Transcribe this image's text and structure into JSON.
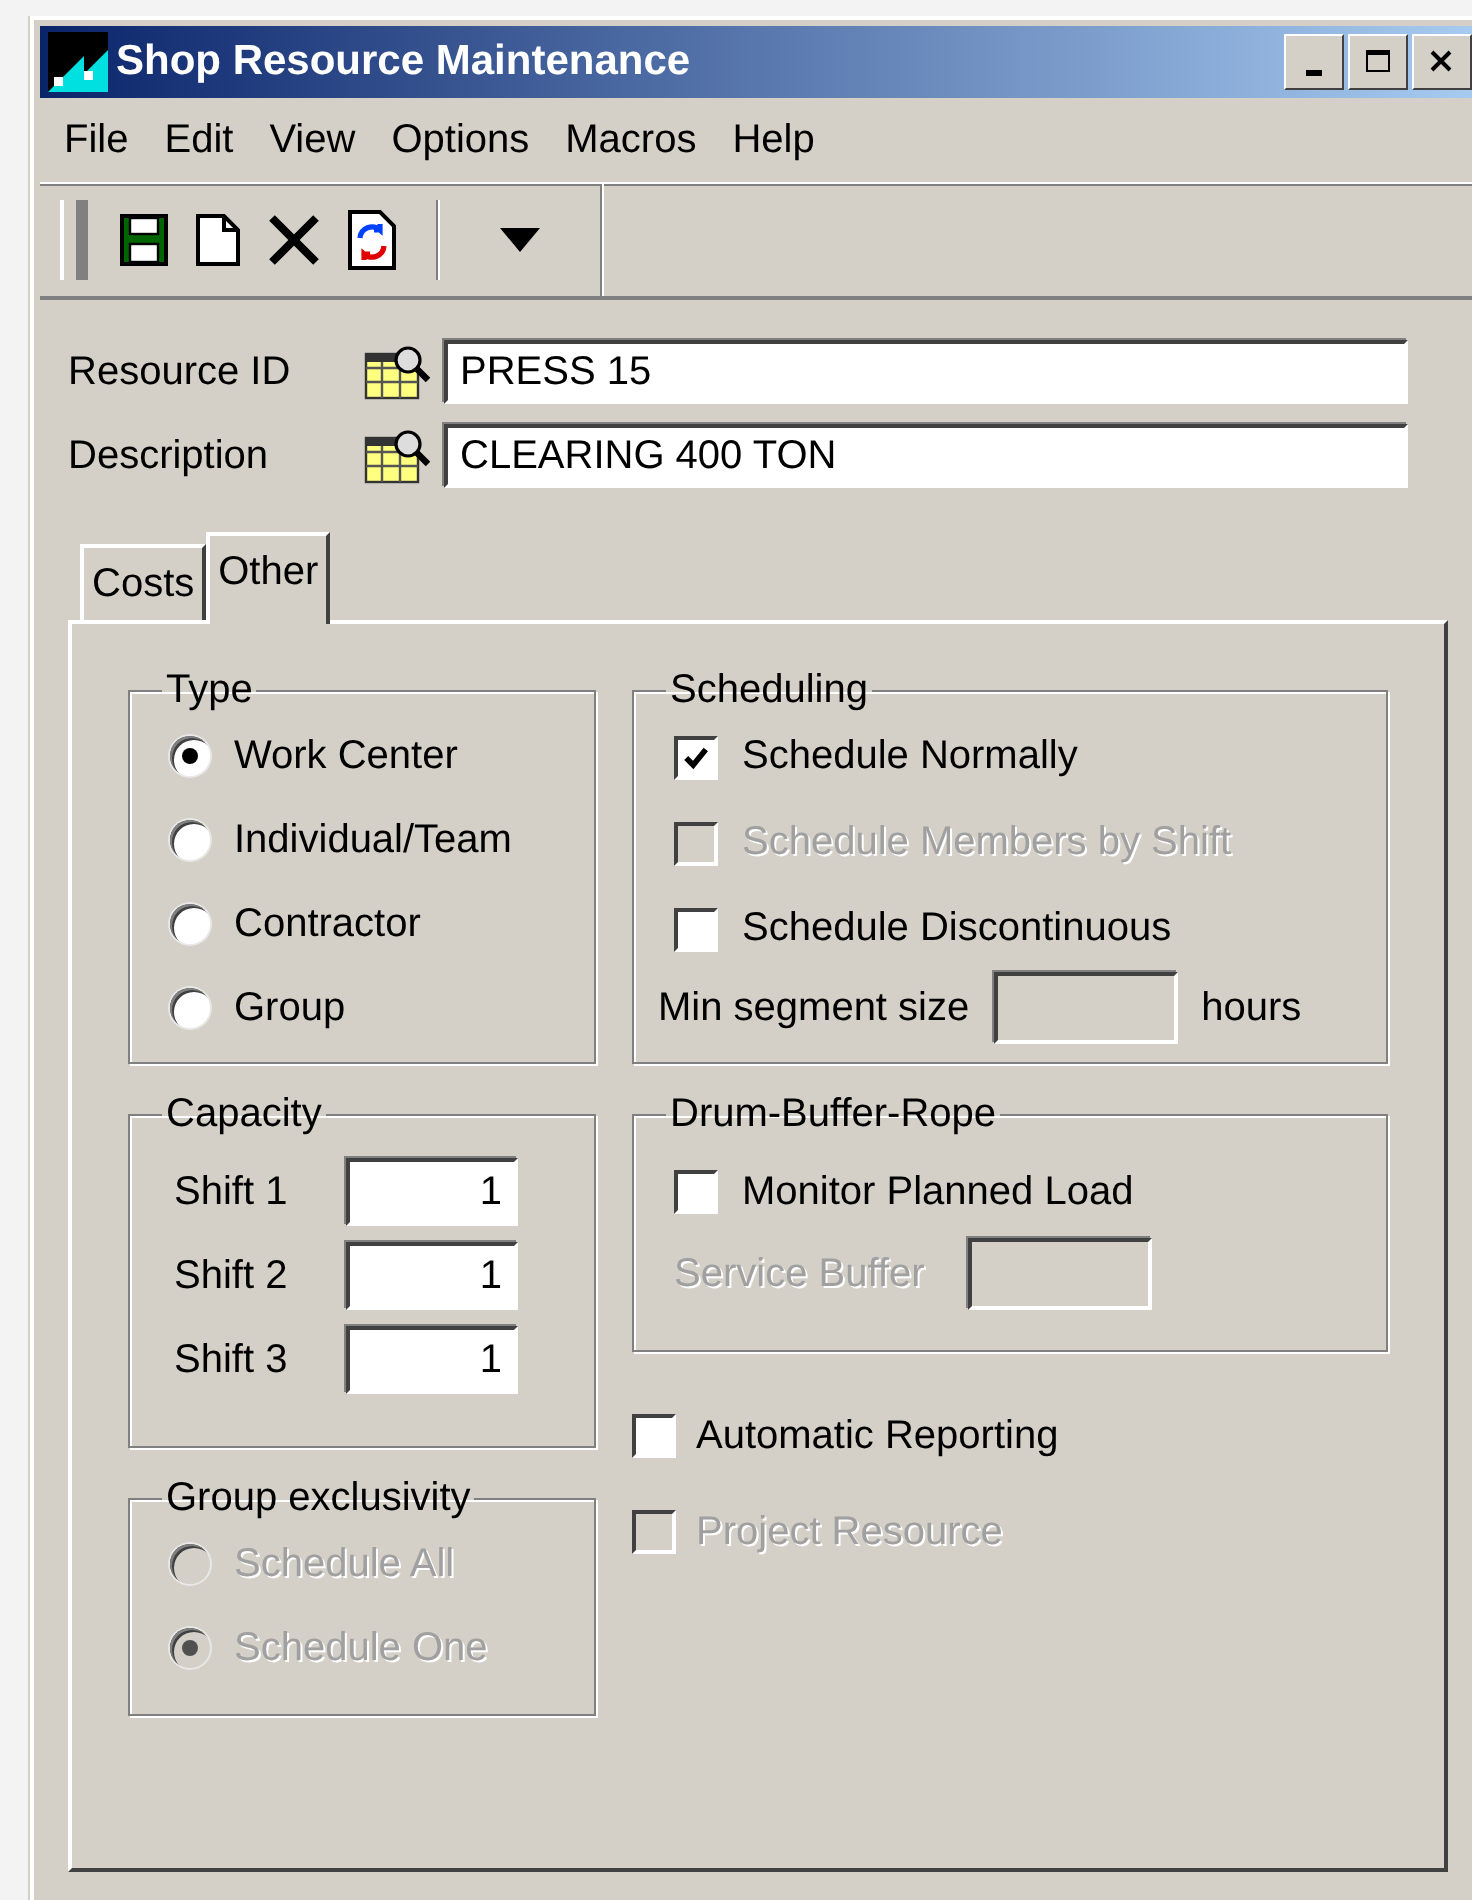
{
  "window": {
    "title": "Shop Resource Maintenance"
  },
  "menu": [
    {
      "label": "File"
    },
    {
      "label": "Edit"
    },
    {
      "label": "View"
    },
    {
      "label": "Options"
    },
    {
      "label": "Macros"
    },
    {
      "label": "Help"
    }
  ],
  "fields": [
    {
      "label": "Resource ID",
      "value": "PRESS 15"
    },
    {
      "label": "Description",
      "value": "CLEARING 400 TON"
    }
  ],
  "tabs": [
    {
      "label": "Costs",
      "selected": false
    },
    {
      "label": "Other",
      "selected": true
    }
  ],
  "type_group": {
    "title": "Type",
    "options": [
      {
        "label": "Work Center",
        "selected": true,
        "disabled": false
      },
      {
        "label": "Individual/Team",
        "selected": false,
        "disabled": false
      },
      {
        "label": "Contractor",
        "selected": false,
        "disabled": false
      },
      {
        "label": "Group",
        "selected": false,
        "disabled": false
      }
    ]
  },
  "scheduling": {
    "title": "Scheduling",
    "options": [
      {
        "label": "Schedule Normally",
        "checked": true,
        "disabled": false
      },
      {
        "label": "Schedule Members by Shift",
        "checked": false,
        "disabled": true
      },
      {
        "label": "Schedule Discontinuous",
        "checked": false,
        "disabled": false
      }
    ],
    "min_segment": {
      "label": "Min segment size",
      "unit": "hours"
    }
  },
  "capacity": {
    "title": "Capacity",
    "shifts": [
      {
        "label": "Shift 1",
        "value": "1"
      },
      {
        "label": "Shift 2",
        "value": "1"
      },
      {
        "label": "Shift 3",
        "value": "1"
      }
    ]
  },
  "drum_buffer_rope": {
    "title": "Drum-Buffer-Rope",
    "monitor": {
      "label": "Monitor Planned Load",
      "checked": false,
      "disabled": false
    },
    "service_buffer": {
      "label": "Service Buffer",
      "disabled": true
    }
  },
  "extra_options": [
    {
      "label": "Automatic Reporting",
      "checked": false,
      "disabled": false
    },
    {
      "label": "Project Resource",
      "checked": false,
      "disabled": true
    }
  ],
  "group_exclusivity": {
    "title": "Group exclusivity",
    "options": [
      {
        "label": "Schedule All",
        "selected": false,
        "disabled": true
      },
      {
        "label": "Schedule One",
        "selected": true,
        "disabled": true
      }
    ]
  }
}
